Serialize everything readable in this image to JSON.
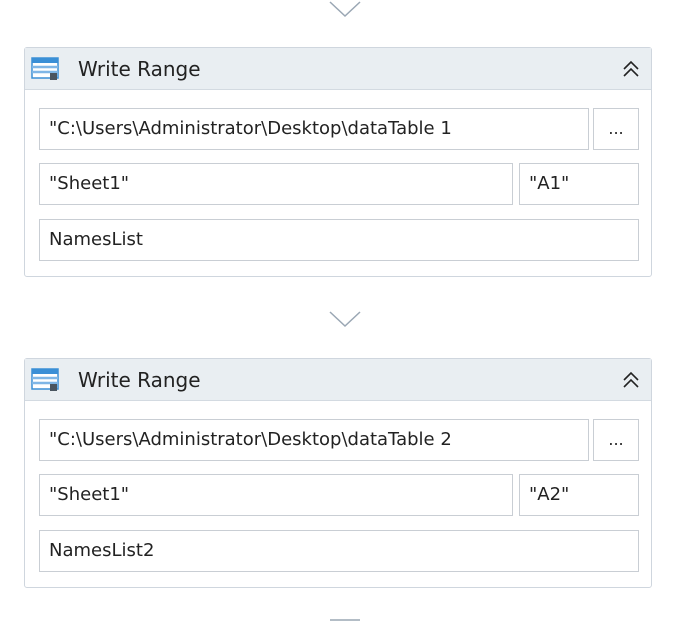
{
  "activities": [
    {
      "title": "Write Range",
      "icon": "write-range-icon",
      "collapse_icon": "double-chevron-up-icon",
      "workbook_path": "\"C:\\Users\\Administrator\\Desktop\\dataTable 1",
      "browse_label": "...",
      "sheet_name": "\"Sheet1\"",
      "start_cell": "\"A1\"",
      "data_table": "NamesList"
    },
    {
      "title": "Write Range",
      "icon": "write-range-icon",
      "collapse_icon": "double-chevron-up-icon",
      "workbook_path": "\"C:\\Users\\Administrator\\Desktop\\dataTable 2",
      "browse_label": "...",
      "sheet_name": "\"Sheet1\"",
      "start_cell": "\"A2\"",
      "data_table": "NamesList2"
    }
  ],
  "connector_icon": "down-triangle-icon",
  "colors": {
    "header_bg": "#e9eef2",
    "border": "#cfd6de",
    "field_border": "#c9ced4",
    "icon_blue": "#3a8fd6",
    "connector": "#9aa7b4"
  }
}
